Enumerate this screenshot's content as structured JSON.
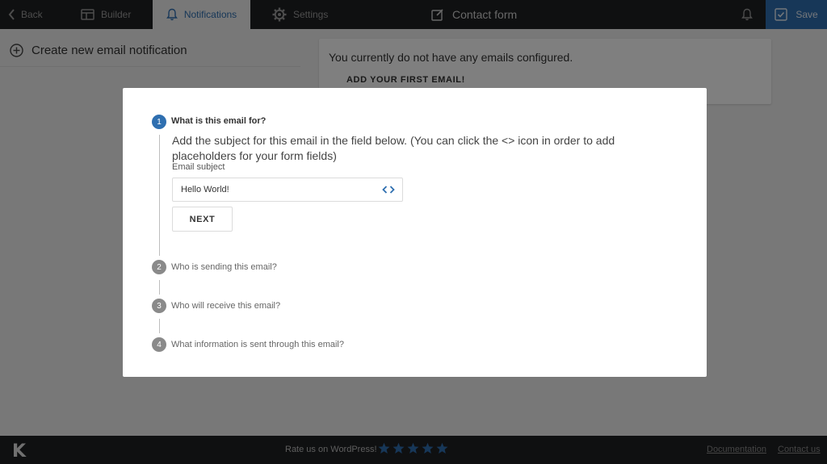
{
  "topbar": {
    "back_label": "Back",
    "builder_label": "Builder",
    "notifications_label": "Notifications",
    "settings_label": "Settings",
    "form_title": "Contact form",
    "save_label": "Save",
    "icons": [
      "chevron-left-icon",
      "builder-icon",
      "bell-icon",
      "gear-icon",
      "edit-icon",
      "bell-icon",
      "save-icon"
    ]
  },
  "left_panel": {
    "create_label": "Create new email notification"
  },
  "right_panel": {
    "empty_message": "You currently do not have any emails configured.",
    "add_first_label": "ADD YOUR FIRST EMAIL!"
  },
  "modal": {
    "steps": [
      {
        "number": "1",
        "title": "What is this email for?",
        "active": true
      },
      {
        "number": "2",
        "title": "Who is sending this email?",
        "active": false
      },
      {
        "number": "3",
        "title": "Who will receive this email?",
        "active": false
      },
      {
        "number": "4",
        "title": "What information is sent through this email?",
        "active": false
      }
    ],
    "description": "Add the subject for this email in the field below. (You can click the <> icon in order to add placeholders for your form fields)",
    "field_label": "Email subject",
    "subject_value": "Hello World!",
    "next_label": "NEXT"
  },
  "footer": {
    "logo": "K",
    "rate_text": "Rate us on WordPress!",
    "stars_rating": 5,
    "documentation_label": "Documentation",
    "contact_label": "Contact us"
  },
  "colors": {
    "accent": "#2f6fb0",
    "topbar_bg": "#1f2023",
    "panel_bg": "#f0f0f0"
  }
}
